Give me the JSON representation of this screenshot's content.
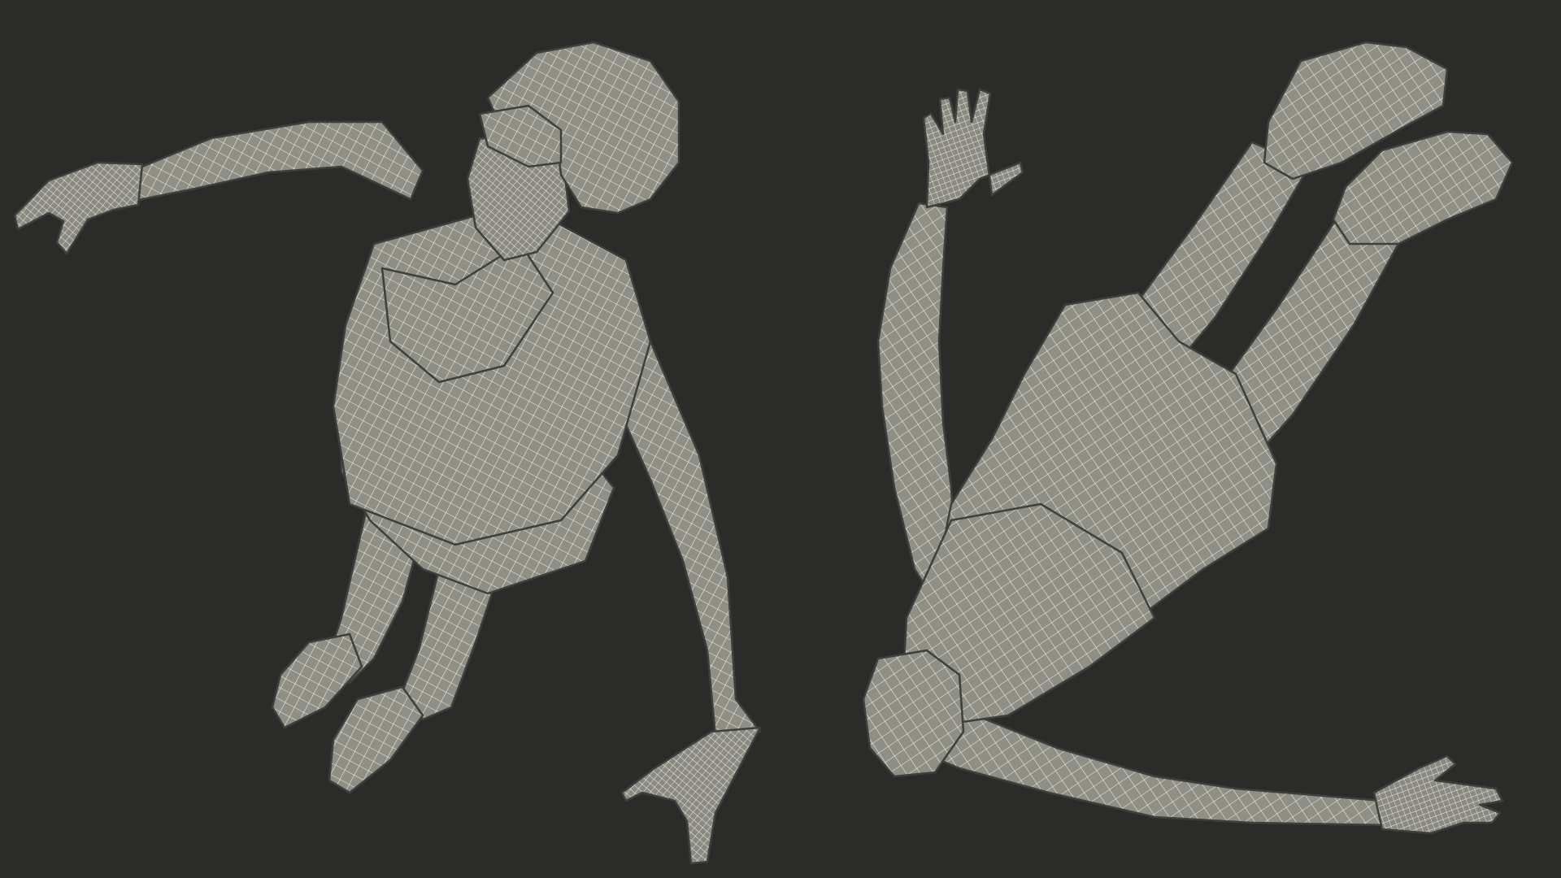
{
  "scene": {
    "description_visible_text": "",
    "colors": {
      "background": "#2b2b29",
      "mesh_fill": "#8f8f86",
      "mesh_shade": "#7d7d75",
      "wire": "#f4f2e6"
    },
    "figures": [
      {
        "id": "figure-left",
        "view": "top-down",
        "label": ""
      },
      {
        "id": "figure-right",
        "view": "bottom-up",
        "label": ""
      }
    ]
  }
}
